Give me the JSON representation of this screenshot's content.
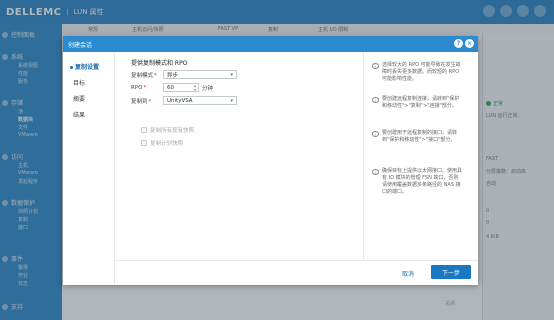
{
  "app": {
    "brand": "DELLEMC",
    "title": "LUN 属性"
  },
  "subtabs": [
    "常规",
    "主机访问/快照",
    "FAST VP",
    "复制",
    "主机 I/O 限制"
  ],
  "nav": {
    "groups": [
      {
        "label": "控制面板"
      },
      {
        "label": "系统",
        "subs": [
          "系统视图",
          "性能",
          "服务"
        ]
      },
      {
        "label": "存储",
        "subs": [
          "池",
          "数据块",
          "文件",
          "VMware"
        ]
      },
      {
        "label": "访问",
        "subs": [
          "主机",
          "VMware",
          "发起程序"
        ]
      },
      {
        "label": "数据保护",
        "subs": [
          "快照计划",
          "复制",
          "接口"
        ]
      },
      {
        "label": "事件",
        "subs": [
          "警报",
          "作业",
          "日志"
        ]
      },
      {
        "label": "支持"
      }
    ]
  },
  "right_panel": {
    "status": "正常",
    "status_detail": "LUN 运行正常。",
    "lines": [
      "FAST",
      "分层策略：启动高",
      "自动",
      "0",
      "0",
      "4 KiB"
    ]
  },
  "bg_close": "关闭",
  "dialog": {
    "title": "创建会话",
    "help_icon": "?",
    "close_icon": "×",
    "steps": [
      {
        "label": "复制设置",
        "active": true
      },
      {
        "label": "目标",
        "active": false
      },
      {
        "label": "摘要",
        "active": false
      },
      {
        "label": "结果",
        "active": false
      }
    ],
    "section_title": "提供复制模式和 RPO",
    "fields": {
      "mode_label": "复制模式",
      "mode_value": "异步",
      "rpo_label": "RPO",
      "rpo_value": "60",
      "rpo_unit": "分钟",
      "target_label": "复制到",
      "target_value": "UnityVSA"
    },
    "checkboxes": [
      "复制所有现有快照",
      "复制计划快照"
    ],
    "help": [
      "选择较大的 RPO 可能导致在发生故障时丢失更多数据。而较短的 RPO 可能影响性能。",
      "要创建远程复制连接，请转到\"保护和移动性\">\"复制\">\"连接\"部分。",
      "要创建用于远程复制的接口，请转到\"保护和移动性\">\"接口\"部分。",
      "确保目标上提供以太网接口。使用具有 IO 模块的管理 FSN 端口，否则请使用覆盖数据多条路径的 NAS 接口的端口。"
    ],
    "cancel_label": "取消",
    "next_label": "下一步"
  }
}
